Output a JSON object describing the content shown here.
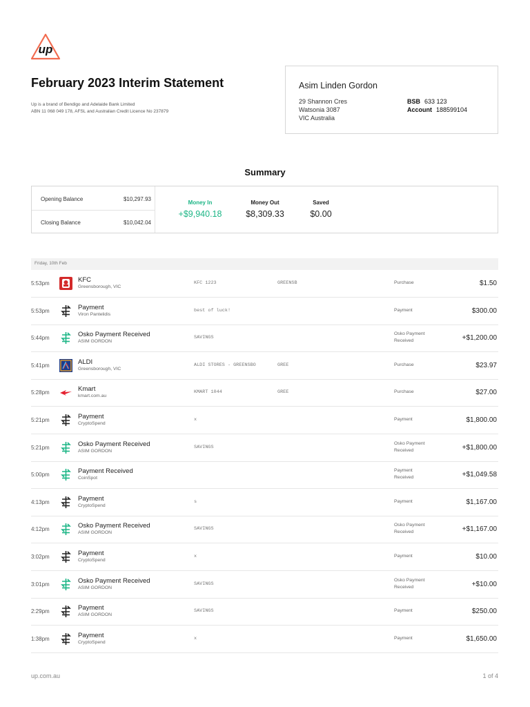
{
  "header": {
    "title": "February 2023 Interim Statement",
    "sub_line1": "Up is a brand of Bendigo and Adelaide Bank Limited",
    "sub_line2": "ABN 11 068 049 178, AFSL and Australian Credit Licence No 237879",
    "logo_text": "up"
  },
  "account": {
    "name": "Asim Linden Gordon",
    "address1": "29 Shannon Cres",
    "address2": "Watsonia 3087",
    "address3": "VIC Australia",
    "bsb_label": "BSB",
    "bsb": "633 123",
    "account_label": "Account",
    "account_number": "188599104"
  },
  "summary": {
    "title": "Summary",
    "opening_label": "Opening Balance",
    "opening_value": "$10,297.93",
    "closing_label": "Closing Balance",
    "closing_value": "$10,042.04",
    "money_in_label": "Money In",
    "money_in": "+$9,940.18",
    "money_out_label": "Money Out",
    "money_out": "$8,309.33",
    "saved_label": "Saved",
    "saved": "$0.00"
  },
  "day_header": "Friday, 10th Feb",
  "transactions": [
    {
      "time": "5:53pm",
      "icon": "kfc-logo-icon",
      "name": "KFC",
      "sub": "Greensborough, VIC",
      "desc": "KFC 1223",
      "desc2": "GREENSB",
      "type": "Purchase",
      "type2": "",
      "amount": "$1.50",
      "positive": false
    },
    {
      "time": "5:53pm",
      "icon": "transfer-icon",
      "name": "Payment",
      "sub": "Viron Pantelidis",
      "desc": "best of luck!",
      "desc2": "",
      "type": "Payment",
      "type2": "",
      "amount": "$300.00",
      "positive": false
    },
    {
      "time": "5:44pm",
      "icon": "transfer-green-icon",
      "name": "Osko Payment Received",
      "sub": "ASIM GORDON",
      "desc": "SAVINGS",
      "desc2": "",
      "type": "Osko Payment",
      "type2": "Received",
      "amount": "+$1,200.00",
      "positive": true
    },
    {
      "time": "5:41pm",
      "icon": "aldi-logo-icon",
      "name": "ALDI",
      "sub": "Greensborough, VIC",
      "desc": "ALDI STORES - GREENSBO",
      "desc2": "GREE",
      "type": "Purchase",
      "type2": "",
      "amount": "$23.97",
      "positive": false
    },
    {
      "time": "5:28pm",
      "icon": "kmart-logo-icon",
      "name": "Kmart",
      "sub": "kmart.com.au",
      "desc": "KMART 1044",
      "desc2": "GREE",
      "type": "Purchase",
      "type2": "",
      "amount": "$27.00",
      "positive": false
    },
    {
      "time": "5:21pm",
      "icon": "transfer-icon",
      "name": "Payment",
      "sub": "CryptoSpend",
      "desc": "x",
      "desc2": "",
      "type": "Payment",
      "type2": "",
      "amount": "$1,800.00",
      "positive": false
    },
    {
      "time": "5:21pm",
      "icon": "transfer-green-icon",
      "name": "Osko Payment Received",
      "sub": "ASIM GORDON",
      "desc": "SAVINGS",
      "desc2": "",
      "type": "Osko Payment",
      "type2": "Received",
      "amount": "+$1,800.00",
      "positive": true
    },
    {
      "time": "5:00pm",
      "icon": "transfer-green-icon",
      "name": "Payment Received",
      "sub": "CoinSpot",
      "desc": "",
      "desc2": "",
      "type": "Payment",
      "type2": "Received",
      "amount": "+$1,049.58",
      "positive": true
    },
    {
      "time": "4:13pm",
      "icon": "transfer-icon",
      "name": "Payment",
      "sub": "CryptoSpend",
      "desc": "s",
      "desc2": "",
      "type": "Payment",
      "type2": "",
      "amount": "$1,167.00",
      "positive": false
    },
    {
      "time": "4:12pm",
      "icon": "transfer-green-icon",
      "name": "Osko Payment Received",
      "sub": "ASIM GORDON",
      "desc": "SAVINGS",
      "desc2": "",
      "type": "Osko Payment",
      "type2": "Received",
      "amount": "+$1,167.00",
      "positive": true
    },
    {
      "time": "3:02pm",
      "icon": "transfer-icon",
      "name": "Payment",
      "sub": "CryptoSpend",
      "desc": "x",
      "desc2": "",
      "type": "Payment",
      "type2": "",
      "amount": "$10.00",
      "positive": false
    },
    {
      "time": "3:01pm",
      "icon": "transfer-green-icon",
      "name": "Osko Payment Received",
      "sub": "ASIM GORDON",
      "desc": "SAVINGS",
      "desc2": "",
      "type": "Osko Payment",
      "type2": "Received",
      "amount": "+$10.00",
      "positive": true
    },
    {
      "time": "2:29pm",
      "icon": "transfer-icon",
      "name": "Payment",
      "sub": "ASIM GORDON",
      "desc": "SAVINGS",
      "desc2": "",
      "type": "Payment",
      "type2": "",
      "amount": "$250.00",
      "positive": false
    },
    {
      "time": "1:38pm",
      "icon": "transfer-icon",
      "name": "Payment",
      "sub": "CryptoSpend",
      "desc": "x",
      "desc2": "",
      "type": "Payment",
      "type2": "",
      "amount": "$1,650.00",
      "positive": false
    }
  ],
  "footer": {
    "website": "up.com.au",
    "page": "1 of 4"
  },
  "colors": {
    "positive": "#1bb585",
    "logo_orange": "#f26b4f",
    "kfc_red": "#d32a2a",
    "aldi_blue": "#1c3c8c",
    "kmart_red": "#e4202f"
  }
}
